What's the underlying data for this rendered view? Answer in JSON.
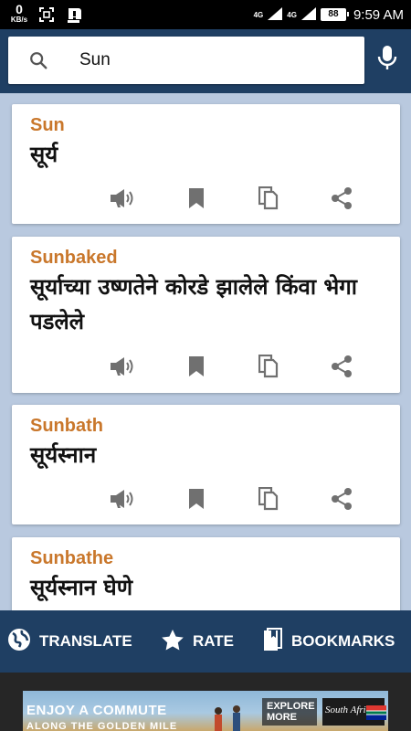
{
  "status_bar": {
    "net_speed_value": "0",
    "net_speed_unit": "KB/s",
    "net_type_1": "4G",
    "net_type_2": "4G",
    "battery": "88",
    "time": "9:59 AM"
  },
  "search": {
    "query": "Sun",
    "placeholder": "",
    "search_icon": "search-icon",
    "mic_icon": "mic-icon"
  },
  "results": [
    {
      "word": "Sun",
      "meaning": "सूर्य"
    },
    {
      "word": "Sunbaked",
      "meaning": "सूर्याच्या उष्णतेने कोरडे झालेले किंवा भेगा पडलेले"
    },
    {
      "word": "Sunbath",
      "meaning": "सूर्यस्नान"
    },
    {
      "word": "Sunbathe",
      "meaning": "सूर्यस्नान घेणे"
    }
  ],
  "card_actions": [
    "speaker-icon",
    "bookmark-icon",
    "copy-icon",
    "share-icon"
  ],
  "bottom_nav": {
    "translate": "TRANSLATE",
    "rate": "RATE",
    "bookmarks": "BOOKMARKS"
  },
  "ad": {
    "headline": "ENJOY A COMMUTE",
    "subline": "ALONG THE GOLDEN MILE",
    "cta": "EXPLORE MORE",
    "brand": "South Africa"
  },
  "colors": {
    "app_bar": "#1f3f63",
    "background": "#b9c9df",
    "word": "#c9772b",
    "icon_gray": "#707070"
  }
}
